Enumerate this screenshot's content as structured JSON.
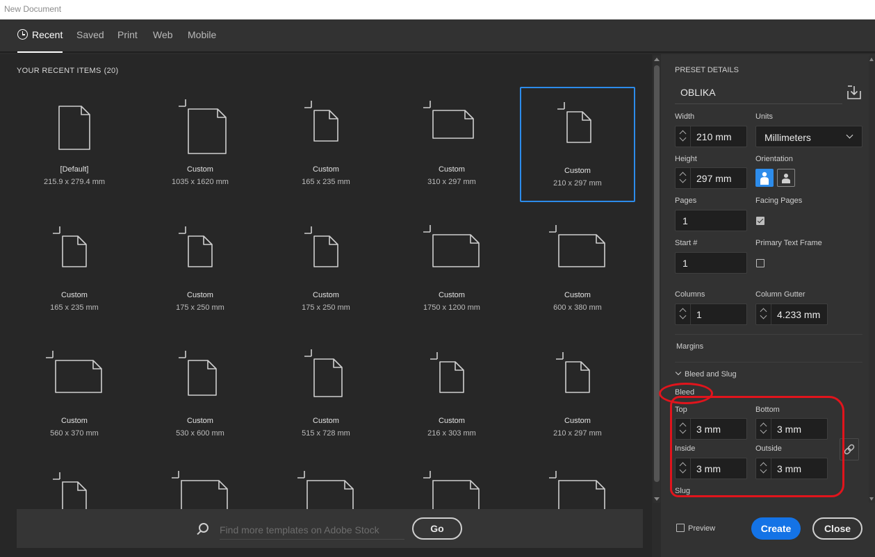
{
  "window": {
    "title": "New Document"
  },
  "tabs": [
    {
      "label": "Recent",
      "active": true
    },
    {
      "label": "Saved"
    },
    {
      "label": "Print"
    },
    {
      "label": "Web"
    },
    {
      "label": "Mobile"
    }
  ],
  "recent": {
    "heading": "YOUR RECENT ITEMS",
    "count": "(20)",
    "items": [
      {
        "name": "[Default]",
        "size": "215.9 x 279.4 mm",
        "icon": "document-icon"
      },
      {
        "name": "Custom",
        "size": "1035 x 1620 mm",
        "icon": "document-icon"
      },
      {
        "name": "Custom",
        "size": "165 x 235 mm",
        "icon": "document-icon"
      },
      {
        "name": "Custom",
        "size": "310 x 297 mm",
        "icon": "document-icon"
      },
      {
        "name": "Custom",
        "size": "210 x 297 mm",
        "icon": "document-icon",
        "selected": true
      },
      {
        "name": "Custom",
        "size": "165 x 235 mm",
        "icon": "document-icon"
      },
      {
        "name": "Custom",
        "size": "175 x 250 mm",
        "icon": "document-icon"
      },
      {
        "name": "Custom",
        "size": "175 x 250 mm",
        "icon": "document-icon"
      },
      {
        "name": "Custom",
        "size": "1750 x 1200 mm",
        "icon": "document-icon"
      },
      {
        "name": "Custom",
        "size": "600 x 380 mm",
        "icon": "document-icon"
      },
      {
        "name": "Custom",
        "size": "560 x 370 mm",
        "icon": "document-icon"
      },
      {
        "name": "Custom",
        "size": "530 x 600 mm",
        "icon": "document-icon"
      },
      {
        "name": "Custom",
        "size": "515 x 728 mm",
        "icon": "document-icon"
      },
      {
        "name": "Custom",
        "size": "216 x 303 mm",
        "icon": "document-icon"
      },
      {
        "name": "Custom",
        "size": "210 x 297 mm",
        "icon": "document-icon"
      }
    ]
  },
  "search": {
    "placeholder": "Find more templates on Adobe Stock",
    "go_label": "Go"
  },
  "preset": {
    "heading": "PRESET DETAILS",
    "name": "OBLIKA",
    "width_label": "Width",
    "width": "210 mm",
    "units_label": "Units",
    "units": "Millimeters",
    "height_label": "Height",
    "height": "297 mm",
    "orientation_label": "Orientation",
    "pages_label": "Pages",
    "pages": "1",
    "facing_label": "Facing Pages",
    "facing": true,
    "start_label": "Start #",
    "start": "1",
    "ptf_label": "Primary Text Frame",
    "ptf": false,
    "columns_label": "Columns",
    "columns": "1",
    "gutter_label": "Column Gutter",
    "gutter": "4.233 mm",
    "margins_label": "Margins",
    "bleed_slug_label": "Bleed and Slug",
    "bleed_label": "Bleed",
    "top_label": "Top",
    "top": "3 mm",
    "bottom_label": "Bottom",
    "bottom": "3 mm",
    "inside_label": "Inside",
    "inside": "3 mm",
    "outside_label": "Outside",
    "outside": "3 mm",
    "slug_label": "Slug"
  },
  "footer": {
    "preview_label": "Preview",
    "create_label": "Create",
    "close_label": "Close"
  },
  "colors": {
    "accent": "#1473e6",
    "selection": "#2d8ceb",
    "annotation": "#e1141c"
  }
}
